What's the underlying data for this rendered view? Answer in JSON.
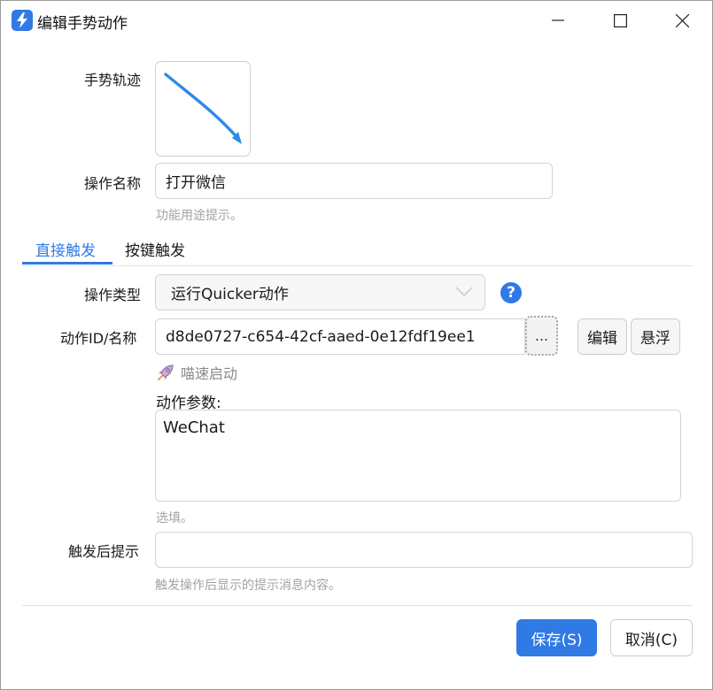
{
  "window": {
    "title": "编辑手势动作"
  },
  "form": {
    "gesture_label": "手势轨迹",
    "name_label": "操作名称",
    "name_value": "打开微信",
    "name_hint": "功能用途提示。",
    "action_type_label": "操作类型",
    "action_type_value": "运行Quicker动作",
    "action_id_label": "动作ID/名称",
    "action_id_value": "d8de0727-c654-42cf-aaed-0e12fdf19ee1",
    "browse_label": "...",
    "edit_label": "编辑",
    "float_label": "悬浮",
    "quick_launch": "喵速启动",
    "params_label": "动作参数:",
    "params_value": "WeChat",
    "params_hint": "选填。",
    "after_label": "触发后提示",
    "after_value": "",
    "after_hint": "触发操作后显示的提示消息内容。"
  },
  "tabs": [
    {
      "label": "直接触发",
      "active": true
    },
    {
      "label": "按键触发",
      "active": false
    }
  ],
  "footer": {
    "save_label": "保存(S)",
    "cancel_label": "取消(C)"
  },
  "colors": {
    "accent": "#2f7ae5",
    "hint": "#a3a3a3"
  },
  "icons": {
    "app": "quicker-logo-icon",
    "help": "help-icon",
    "rocket": "rocket-icon",
    "gesture": "gesture-arrow-icon"
  }
}
